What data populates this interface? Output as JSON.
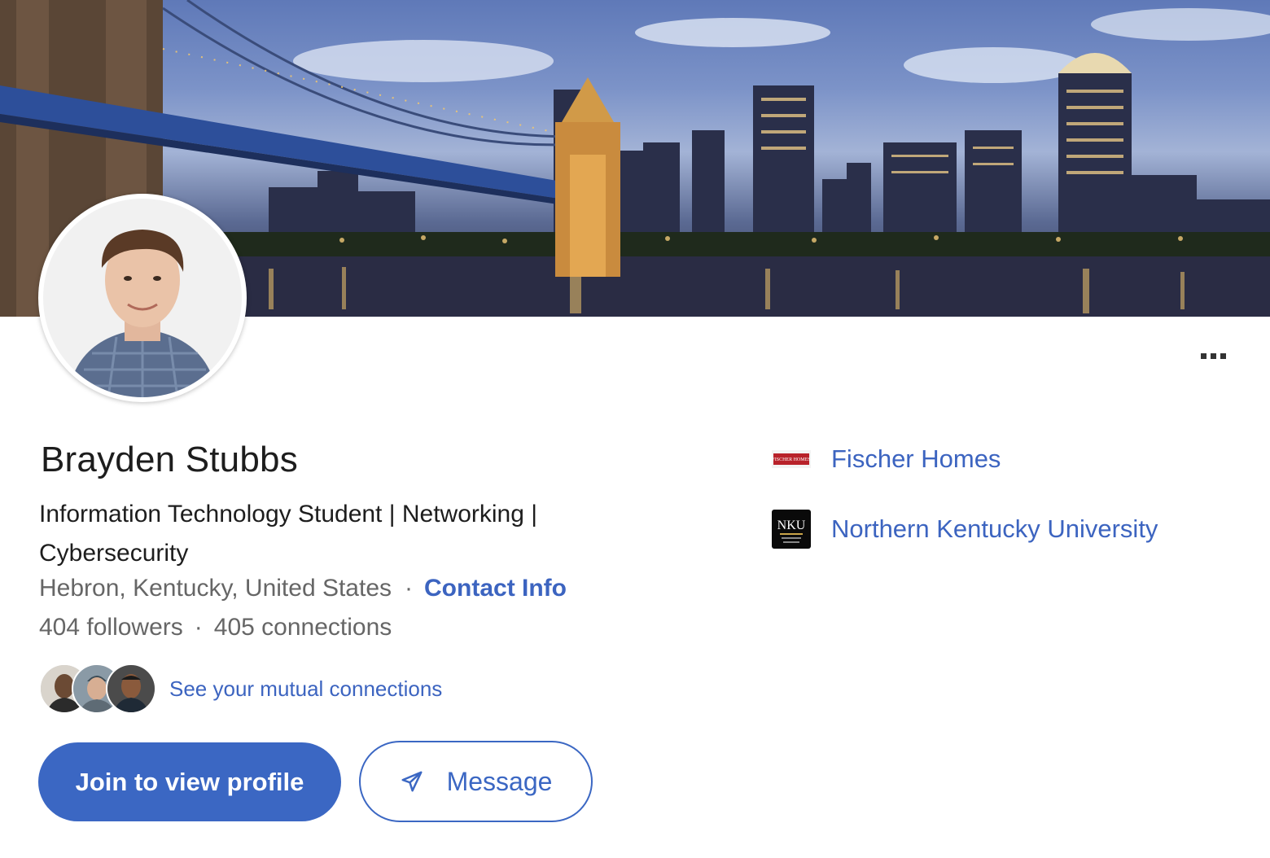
{
  "profile": {
    "name": "Brayden Stubbs",
    "headline": "Information Technology Student | Networking | Cybersecurity",
    "location": "Hebron, Kentucky, United States",
    "separator": "·",
    "contact_info_label": "Contact Info",
    "followers": "404 followers",
    "connections": "405 connections",
    "mutual_connections_label": "See your mutual connections"
  },
  "actions": {
    "join_label": "Join to view profile",
    "message_label": "Message",
    "more_label": "More actions"
  },
  "experience": {
    "current_company": "Fischer Homes",
    "company_logo_text": "FISCHER HOMES"
  },
  "education": {
    "school": "Northern Kentucky University",
    "school_logo_text": "NKU"
  },
  "colors": {
    "accent": "#3b67c3",
    "link": "#3c64c0",
    "text_primary": "#1d1d1d",
    "text_secondary": "#666666"
  },
  "icons": {
    "more": "ellipsis-icon",
    "message": "send-icon"
  }
}
